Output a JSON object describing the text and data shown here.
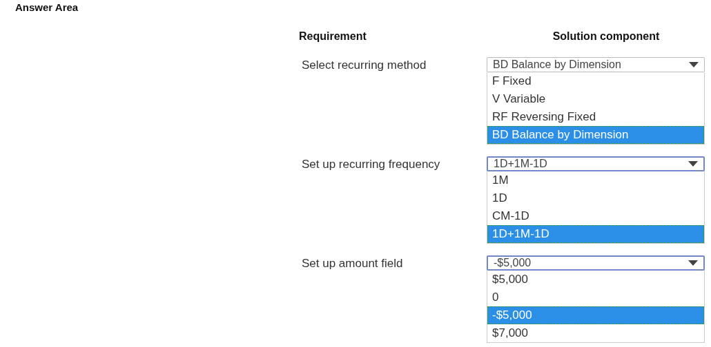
{
  "title": "Answer Area",
  "headers": [
    "Requirement",
    "Solution component"
  ],
  "rows": [
    {
      "requirement": "Select recurring method",
      "dropdown": {
        "value": "BD Balance by Dimension",
        "focused": false,
        "options": [
          {
            "label": "F Fixed",
            "selected": false
          },
          {
            "label": "V Variable",
            "selected": false
          },
          {
            "label": "RF Reversing Fixed",
            "selected": false
          },
          {
            "label": "BD Balance by Dimension",
            "selected": true
          }
        ]
      }
    },
    {
      "requirement": "Set up recurring frequency",
      "dropdown": {
        "value": "1D+1M-1D",
        "focused": true,
        "options": [
          {
            "label": "1M",
            "selected": false
          },
          {
            "label": "1D",
            "selected": false
          },
          {
            "label": "CM-1D",
            "selected": false
          },
          {
            "label": "1D+1M-1D",
            "selected": true
          }
        ]
      }
    },
    {
      "requirement": "Set up amount field",
      "dropdown": {
        "value": "-$5,000",
        "focused": true,
        "options": [
          {
            "label": "$5,000",
            "selected": false
          },
          {
            "label": "0",
            "selected": false
          },
          {
            "label": "-$5,000",
            "selected": true
          },
          {
            "label": "$7,000",
            "selected": false
          }
        ]
      }
    }
  ]
}
